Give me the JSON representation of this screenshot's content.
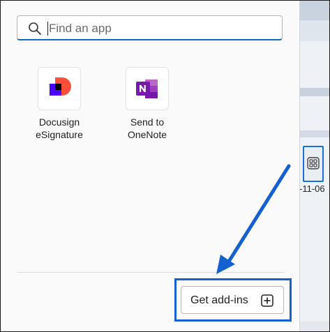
{
  "search": {
    "placeholder": "Find an app"
  },
  "apps": [
    {
      "label_line1": "Docusign",
      "label_line2": "eSignature",
      "icon": "docusign-icon"
    },
    {
      "label_line1": "Send to",
      "label_line2": "OneNote",
      "icon": "onenote-icon"
    }
  ],
  "footer": {
    "get_addins_label": "Get add-ins",
    "plus_icon": "plus-square-icon"
  },
  "background": {
    "date_fragment": "-11-06",
    "apps_button_icon": "apps-grid-icon"
  },
  "colors": {
    "accent": "#0f6cbd",
    "annotation_blue": "#1560d0",
    "docusign_red": "#ff4f3b",
    "docusign_purple": "#4c00ff",
    "onenote_purple": "#7719aa"
  }
}
